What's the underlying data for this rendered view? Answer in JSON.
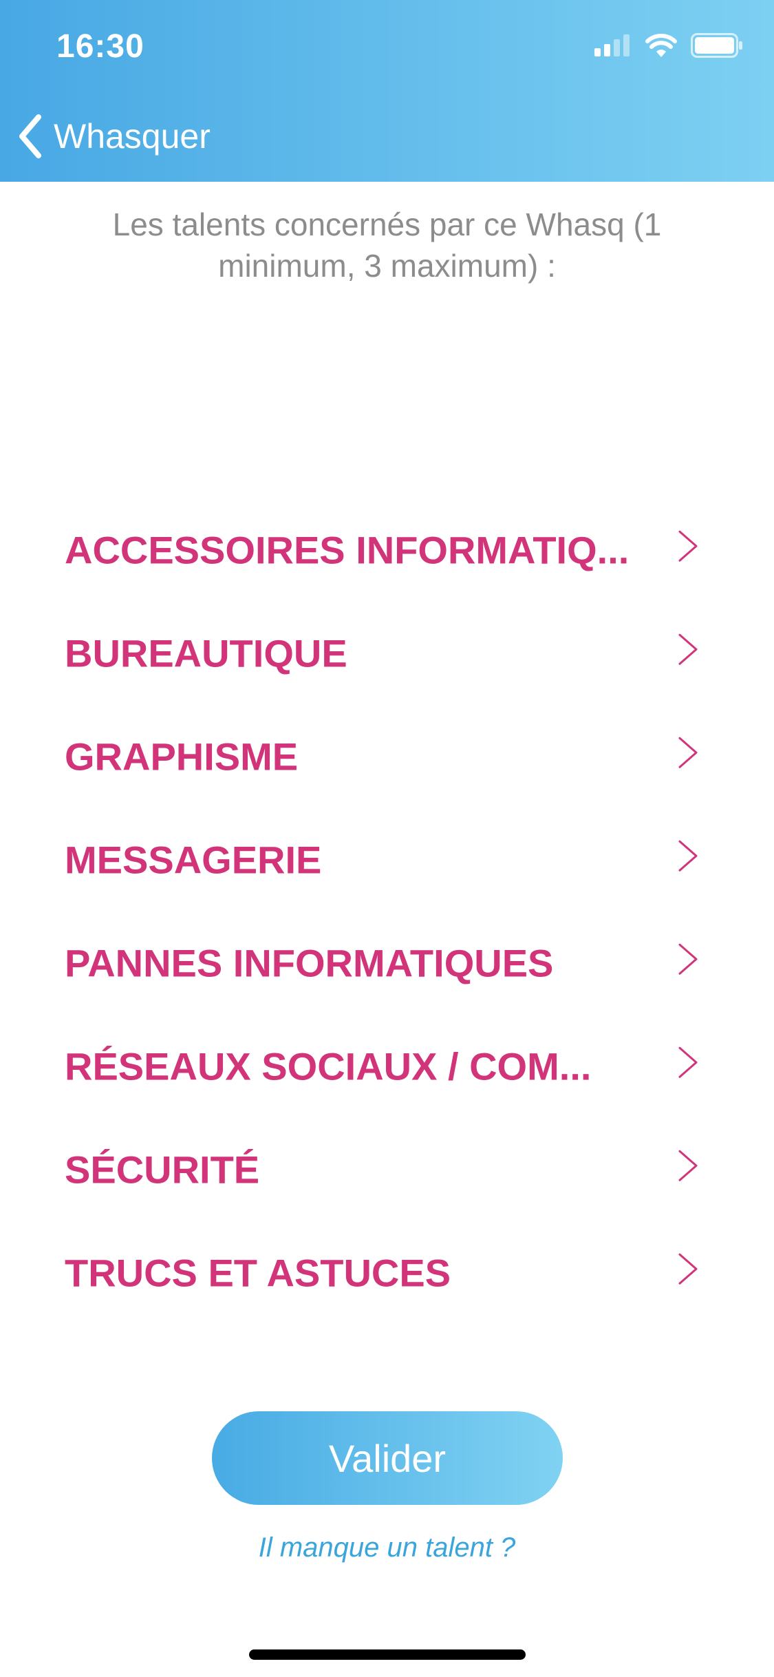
{
  "status_bar": {
    "time": "16:30",
    "icons": [
      "signal-icon",
      "wifi-icon",
      "battery-icon"
    ]
  },
  "nav": {
    "back_label": "Whasquer",
    "back_icon": "chevron-left-icon"
  },
  "intro": {
    "text": "Les talents concernés par ce Whasq (1 minimum, 3 maximum) :"
  },
  "talents": [
    {
      "label": "ACCESSOIRES INFORMATIQ..."
    },
    {
      "label": "BUREAUTIQUE"
    },
    {
      "label": "GRAPHISME"
    },
    {
      "label": "MESSAGERIE"
    },
    {
      "label": "PANNES INFORMATIQUES"
    },
    {
      "label": "RÉSEAUX SOCIAUX / COM..."
    },
    {
      "label": "SÉCURITÉ"
    },
    {
      "label": "TRUCS ET ASTUCES"
    }
  ],
  "actions": {
    "validate_label": "Valider",
    "missing_talent_link": "Il manque un talent ?"
  },
  "colors": {
    "header_gradient_start": "#48a8e4",
    "header_gradient_end": "#7dd0f2",
    "talent_text": "#d2347a",
    "intro_text": "#8c8c8c",
    "link_text": "#3aa5dc"
  }
}
